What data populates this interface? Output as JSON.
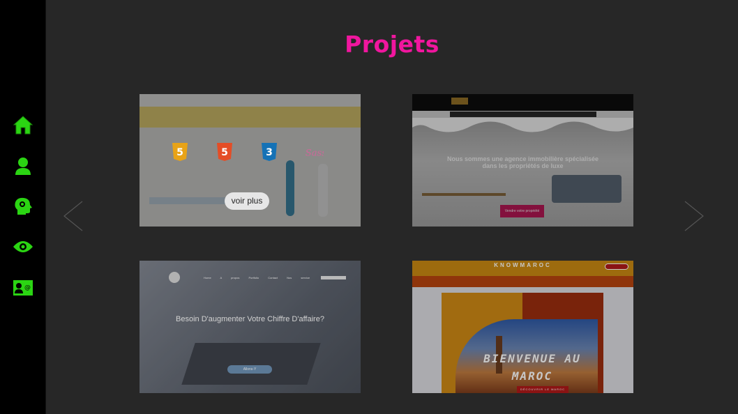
{
  "sidebar": {
    "items": [
      {
        "icon": "home-icon"
      },
      {
        "icon": "user-icon"
      },
      {
        "icon": "skills-head-gear-icon"
      },
      {
        "icon": "eye-icon"
      },
      {
        "icon": "contact-card-icon"
      }
    ],
    "accent_color": "#2bd513"
  },
  "main": {
    "title": "Projets",
    "title_color": "#f0169e",
    "projects": [
      {
        "techs": [
          "html5-icon",
          "html5-icon",
          "css3-icon",
          "sass-icon"
        ],
        "hover_label": "voir plus"
      },
      {
        "heading_lines": [
          "Nous sommes une agence immobilière spécialisée",
          "dans les propriétés de luxe"
        ],
        "button": "Vendre votre propriété"
      },
      {
        "heading": "Besoin D'augmenter Votre Chiffre D'affaire?",
        "nav": "Home A propos Portfolio Contact Nos service",
        "button": "Allons-Y"
      },
      {
        "brand": "KNOWMAROC",
        "heading_lines": [
          "BIENVENUE AU",
          "MAROC"
        ],
        "cta": "DÉCOUVRIR LE MAROC"
      }
    ]
  }
}
